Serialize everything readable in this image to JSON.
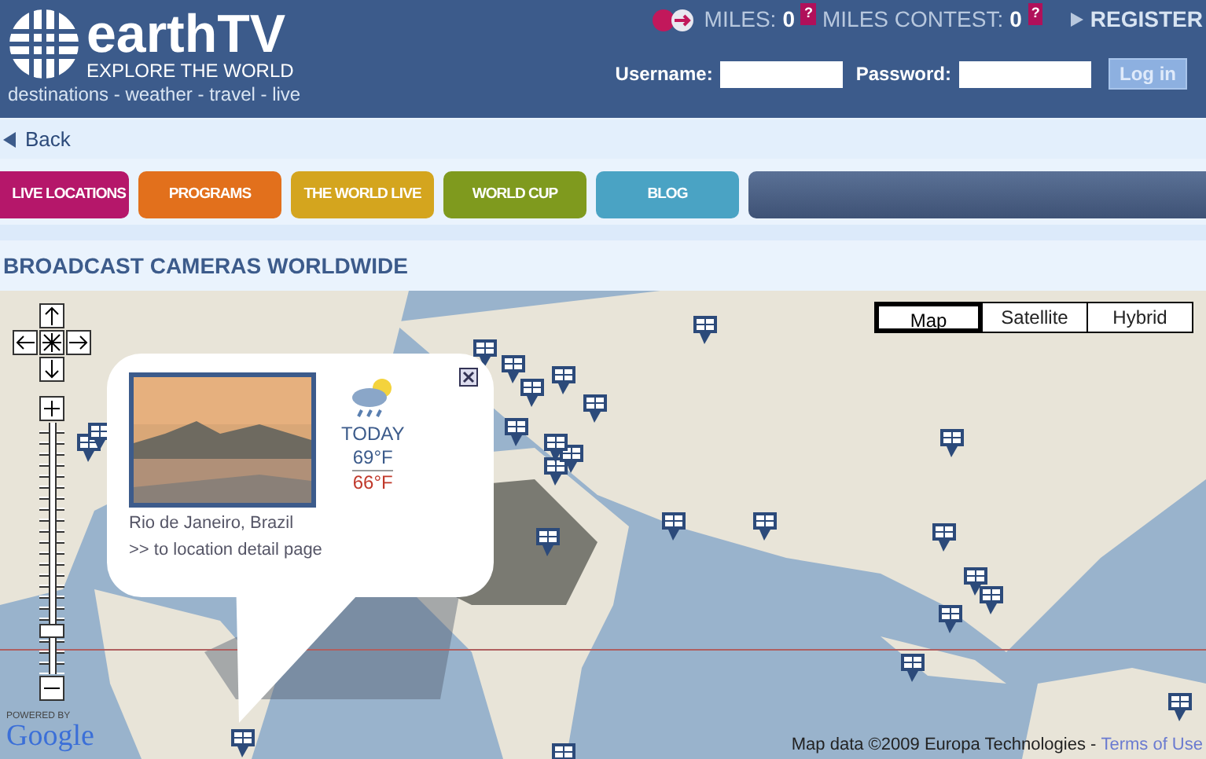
{
  "header": {
    "logo": "earthTV",
    "tagline": "EXPLORE THE WORLD",
    "subline": "destinations - weather - travel - live",
    "miles_label": "MILES:",
    "miles": "0",
    "help": "?",
    "contest_label": "MILES CONTEST:",
    "contest": "0",
    "contest_help": "?",
    "register": "REGISTER",
    "username_label": "Username:",
    "password_label": "Password:",
    "login": "Log in"
  },
  "back": "Back",
  "nav": [
    {
      "label": "LIVE LOCATIONS",
      "color": "#b5176a"
    },
    {
      "label": "PROGRAMS",
      "color": "#e2701c"
    },
    {
      "label": "THE WORLD LIVE",
      "color": "#d4a51e"
    },
    {
      "label": "WORLD CUP",
      "color": "#7f9a1e"
    },
    {
      "label": "BLOG",
      "color": "#4aa3c4"
    }
  ],
  "heading": "BROADCAST CAMERAS WORLDWIDE",
  "map": {
    "types": [
      {
        "label": "Map",
        "selected": true
      },
      {
        "label": "Satellite",
        "selected": false
      },
      {
        "label": "Hybrid",
        "selected": false
      }
    ],
    "zoom": {
      "level": 0.15
    },
    "popup": {
      "location": "Rio de Janeiro, Brazil",
      "link": ">> to location detail page",
      "day": "TODAY",
      "high": "69°F",
      "low": "66°F"
    },
    "powered": "POWERED BY",
    "google": "Google",
    "attribution": "Map data ©2009 Europa Technologies -",
    "terms": "Terms of Use"
  }
}
